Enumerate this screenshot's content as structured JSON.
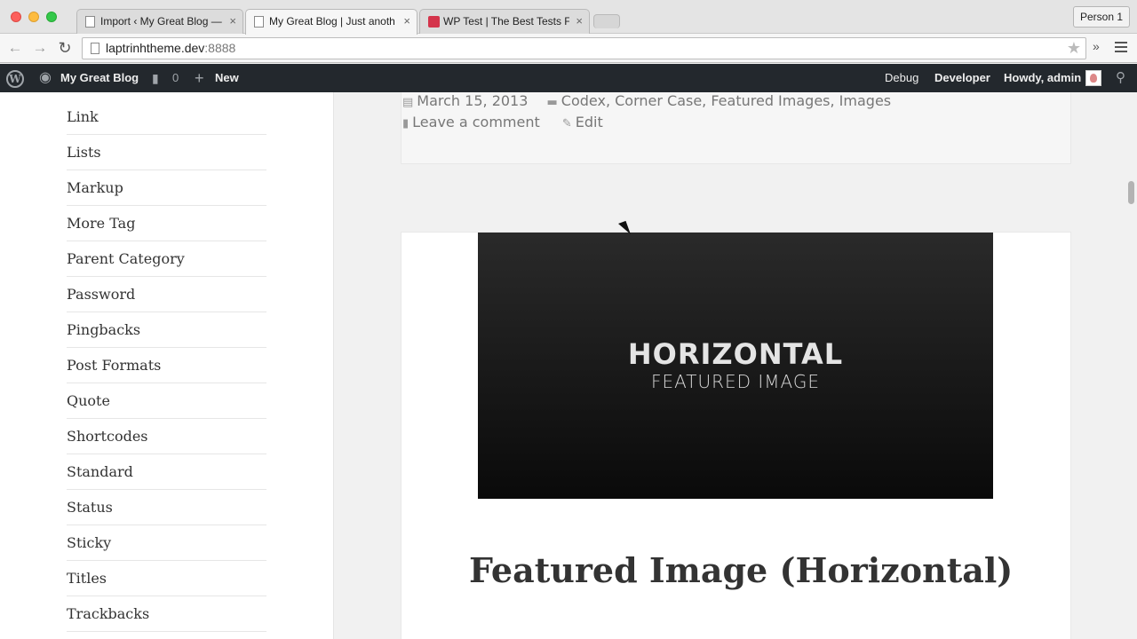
{
  "browser": {
    "tabs": [
      {
        "title": "Import ‹ My Great Blog — W",
        "icon": "page-icon"
      },
      {
        "title": "My Great Blog | Just anoth",
        "icon": "page-icon"
      },
      {
        "title": "WP Test | The Best Tests F",
        "icon": "wptest-icon"
      }
    ],
    "close_glyph": "×",
    "person_label": "Person 1",
    "url_host": "laptrinhtheme.dev",
    "url_port": ":8888",
    "more_glyph": "»"
  },
  "adminbar": {
    "site_name": "My Great Blog",
    "comment_count": "0",
    "new_label": "New",
    "debug_label": "Debug",
    "developer_label": "Developer",
    "howdy_label": "Howdy, admin"
  },
  "sidebar": {
    "categories": [
      "Link",
      "Lists",
      "Markup",
      "More Tag",
      "Parent Category",
      "Password",
      "Pingbacks",
      "Post Formats",
      "Quote",
      "Shortcodes",
      "Standard",
      "Status",
      "Sticky",
      "Titles",
      "Trackbacks"
    ]
  },
  "post_previous": {
    "date": "March 15, 2013",
    "categories_text": "Codex, Corner Case, Featured Images, Images",
    "comment_link": "Leave a comment",
    "edit_link": "Edit"
  },
  "post": {
    "image_heading": "HORIZONTAL",
    "image_subheading": "FEATURED IMAGE",
    "title": "Featured Image (Horizontal)"
  }
}
